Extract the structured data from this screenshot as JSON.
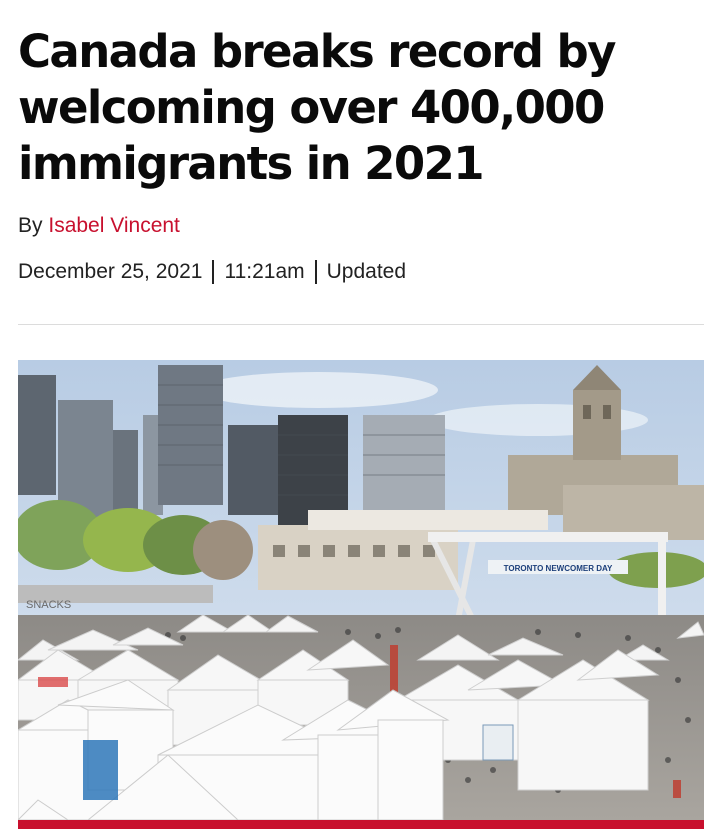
{
  "article": {
    "headline": "Canada breaks record by welcoming over 400,000 immigrants in 2021",
    "byline_prefix": "By",
    "author": "Isabel Vincent",
    "date": "December 25, 2021",
    "time": "11:21am",
    "updated_label": "Updated"
  },
  "photo": {
    "banner_text": "TORONTO NEWCOMER DAY",
    "snacks_sign": "SNACKS"
  },
  "colors": {
    "accent": "#c8102e",
    "text": "#222222"
  }
}
